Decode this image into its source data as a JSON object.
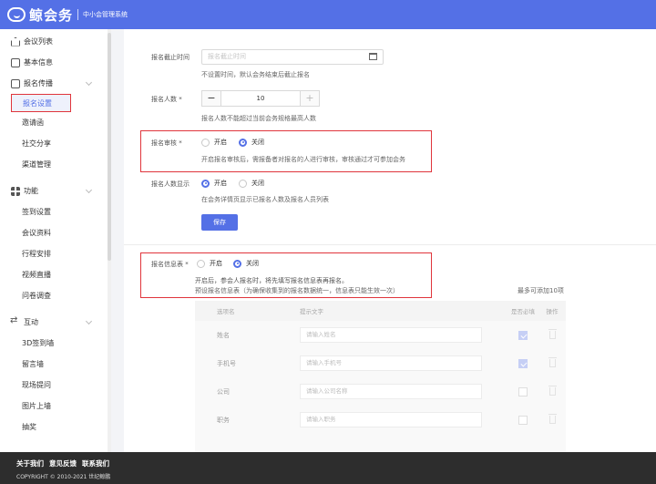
{
  "header": {
    "brand": "鲸会务",
    "subtitle": "中小会管理系统"
  },
  "sidebar": {
    "groups": [
      {
        "label": "会议列表",
        "icon": "home-icon"
      },
      {
        "label": "基本信息",
        "icon": "document-icon"
      },
      {
        "label": "报名传播",
        "icon": "edit-icon"
      }
    ],
    "signup_items": [
      "报名设置",
      "邀请函",
      "社交分享",
      "渠道管理"
    ],
    "func_group": "功能",
    "func_items": [
      "签到设置",
      "会议资料",
      "行程安排",
      "视频直播",
      "问卷调查"
    ],
    "interact_group": "互动",
    "interact_items": [
      "3D签到墙",
      "留言墙",
      "现场提问",
      "图片上墙",
      "抽奖"
    ]
  },
  "form": {
    "deadline": {
      "label": "报名截止时间",
      "placeholder": "报名截止时间",
      "hint": "不设置时间，默认会务结束后截止报名"
    },
    "count": {
      "label": "报名人数 *",
      "value": "10",
      "minus": "−",
      "plus": "+",
      "hint": "报名人数不能超过当前会务规格最高人数"
    },
    "review": {
      "label": "报名审核 *",
      "on": "开启",
      "off": "关闭",
      "hint": "开启报名审核后，需报备者对报名的人进行审核，审核通过才可参加会务"
    },
    "display": {
      "label": "报名人数显示",
      "on": "开启",
      "off": "关闭",
      "hint": "在会务详情页显示已报名人数及报名人员列表"
    },
    "save": "保存",
    "info_table": {
      "label": "报名信息表 *",
      "on": "开启",
      "off": "关闭",
      "hint1": "开启后，参会人报名时，将先填写报名信息表再报名。",
      "hint2": "预设报名信息表（为确保收集到的报名数据统一，信息表只能生效一次）",
      "max_hint": "最多可添加10项",
      "headers": [
        "选项名",
        "提示文字",
        "是否必填",
        "操作"
      ],
      "rows": [
        {
          "name": "姓名",
          "placeholder": "请输入姓名",
          "required": true
        },
        {
          "name": "手机号",
          "placeholder": "请输入手机号",
          "required": true
        },
        {
          "name": "公司",
          "placeholder": "请输入公司名称",
          "required": false
        },
        {
          "name": "职务",
          "placeholder": "请输入职务",
          "required": false
        }
      ]
    }
  },
  "footer": {
    "links": [
      "关于我们",
      "意见反馈",
      "联系我们"
    ],
    "copyright": "COPYRIGHT © 2010-2021 世纪鲸鹏"
  }
}
